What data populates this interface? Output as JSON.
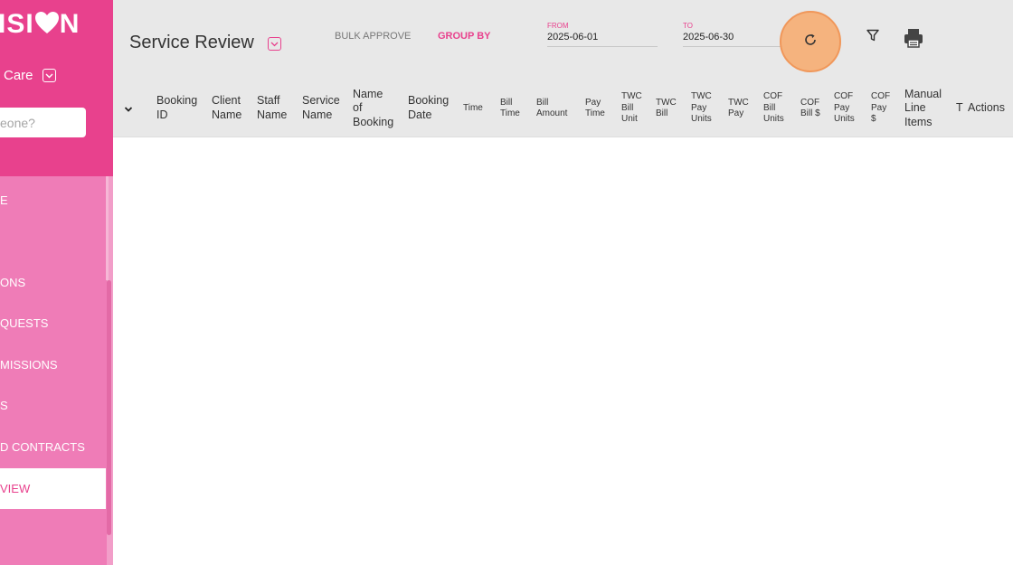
{
  "sidebar": {
    "logo": "ISI",
    "logo_end": "N",
    "org_name": "Care",
    "search_placeholder": "eone?",
    "items": [
      {
        "label": "E"
      },
      {
        "label": "ONS"
      },
      {
        "label": "QUESTS"
      },
      {
        "label": "MISSIONS"
      },
      {
        "label": "S"
      },
      {
        "label": "D CONTRACTS"
      },
      {
        "label": "VIEW",
        "active": true
      }
    ]
  },
  "header": {
    "title": "Service Review",
    "bulk_approve": "BULK APPROVE",
    "group_by": "GROUP BY",
    "from_label": "FROM",
    "from_value": "2025-06-01",
    "to_label": "TO",
    "to_value": "2025-06-30"
  },
  "table": {
    "columns": [
      {
        "label": "Booking ID"
      },
      {
        "label": "Client Name"
      },
      {
        "label": "Staff Name"
      },
      {
        "label": "Service Name"
      },
      {
        "label": "Name of Booking"
      },
      {
        "label": "Booking Date"
      },
      {
        "label": "Time"
      },
      {
        "label": "Bill Time"
      },
      {
        "label": "Bill Amount"
      },
      {
        "label": "Pay Time"
      },
      {
        "label": "TWC Bill Unit"
      },
      {
        "label": "TWC Bill"
      },
      {
        "label": "TWC Pay Units"
      },
      {
        "label": "TWC Pay"
      },
      {
        "label": "COF Bill Units"
      },
      {
        "label": "COF Bill $"
      },
      {
        "label": "COF Pay Units"
      },
      {
        "label": "COF Pay $"
      },
      {
        "label": "Manual Line Items"
      },
      {
        "label": "T"
      },
      {
        "label": "Actions"
      }
    ]
  },
  "colors": {
    "brand_pink": "#e8418d",
    "sidebar_pink": "#ef7cb7",
    "header_gray": "#e8e8e8",
    "highlight_orange": "#f5b37e"
  },
  "icons": {
    "refresh": "refresh-icon",
    "filter": "filter-icon",
    "print": "print-icon",
    "dropdown": "chevron-down-icon",
    "heart": "heart-icon"
  }
}
